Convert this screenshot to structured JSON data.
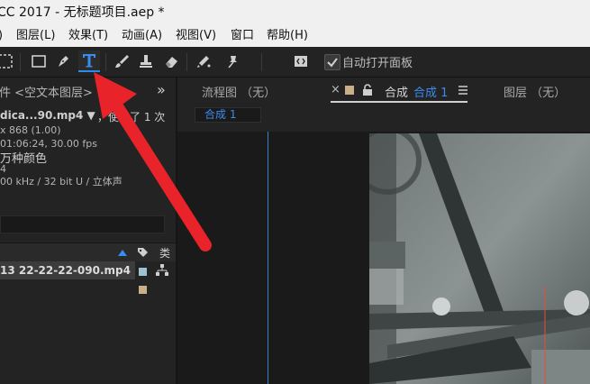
{
  "titlebar": {
    "title": "CC 2017 - 无标题项目.aep *"
  },
  "menubar": {
    "items": [
      "图层(L)",
      "效果(T)",
      "动画(A)",
      "视图(V)",
      "窗口",
      "帮助(H)"
    ],
    "partial_left": ")"
  },
  "toolbar": {
    "auto_open_label": "自动打开面板",
    "accent": "#2d8ceb"
  },
  "project": {
    "header": "件 <空文本图层>",
    "menu_chevron": "»",
    "file_name": "dica...90.mp4 ▼",
    "usage": "，使用了 1 次",
    "dimensions": "x 868 (1.00)",
    "duration": "01:06:24, 30.00 fps",
    "colors": "万种颜色",
    "line4": "4",
    "audio": "00 kHz / 32 bit U / 立体声",
    "type_col": "类",
    "row_name": "13 22-22-22-090.mp4"
  },
  "viewer": {
    "flow_tab": "流程图 （无）",
    "close_x": "×",
    "comp_label": "合成",
    "comp_name": "合成 1",
    "layer_tab": "图层 （无）",
    "comp_subtab": "合成 1"
  },
  "colors": {
    "arrow": "#e8242a",
    "swatch": "#c9b08a"
  }
}
